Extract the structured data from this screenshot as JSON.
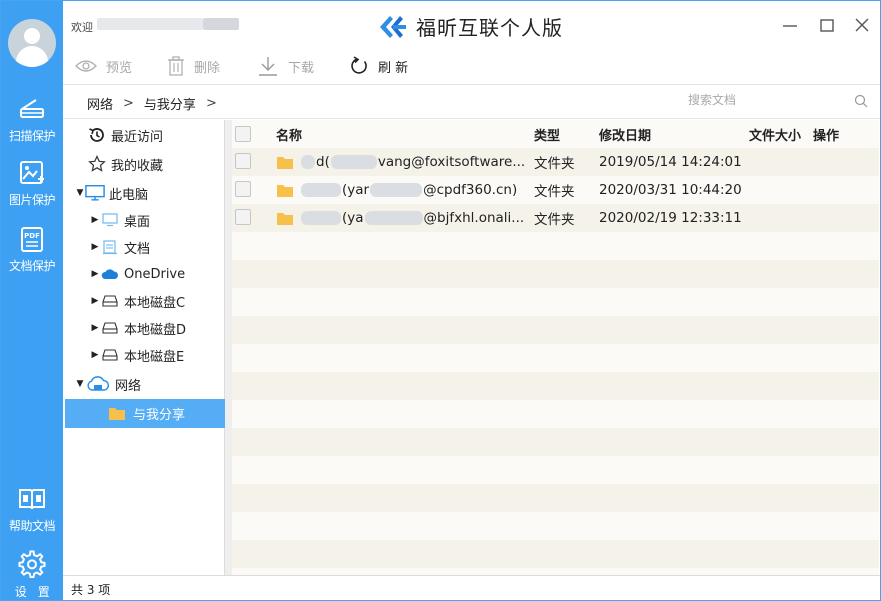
{
  "app": {
    "title": "福昕互联个人版",
    "welcome": "欢迎"
  },
  "rail": {
    "items": [
      {
        "label": "扫描保护",
        "icon": "scanner-icon"
      },
      {
        "label": "图片保护",
        "icon": "image-protect-icon"
      },
      {
        "label": "文档保护",
        "icon": "pdf-icon"
      },
      {
        "label": "帮助文档",
        "icon": "book-icon"
      },
      {
        "label": "设　置",
        "icon": "gear-icon"
      }
    ]
  },
  "toolbar": {
    "preview": "预览",
    "delete": "删除",
    "download": "下载",
    "refresh": "刷 新"
  },
  "breadcrumb": {
    "items": [
      "网络",
      "与我分享"
    ],
    "sep": ">"
  },
  "search": {
    "placeholder": "搜索文档"
  },
  "tree": {
    "recent": "最近访问",
    "favorites": "我的收藏",
    "thispc": "此电脑",
    "desktop": "桌面",
    "documents": "文档",
    "onedrive": "OneDrive",
    "diskC": "本地磁盘C",
    "diskD": "本地磁盘D",
    "diskE": "本地磁盘E",
    "network": "网络",
    "shared": "与我分享"
  },
  "table": {
    "columns": {
      "name": "名称",
      "type": "类型",
      "modified": "修改日期",
      "size": "文件大小",
      "action": "操作"
    },
    "rows": [
      {
        "name_prefix": "d(",
        "name_suffix": "vang@foxitsoftware...",
        "type": "文件夹",
        "modified": "2019/05/14 14:24:01",
        "size": ""
      },
      {
        "name_prefix": "(yar",
        "name_suffix": "@cpdf360.cn)",
        "type": "文件夹",
        "modified": "2020/03/31 10:44:20",
        "size": ""
      },
      {
        "name_prefix": "(ya",
        "name_suffix": "@bjfxhl.onali...",
        "type": "文件夹",
        "modified": "2020/02/19 12:33:11",
        "size": ""
      }
    ]
  },
  "status": {
    "count": "共 3 项"
  },
  "colors": {
    "accent": "#3ea0f2",
    "selected": "#55aef5",
    "folder": "#f7c04a"
  }
}
